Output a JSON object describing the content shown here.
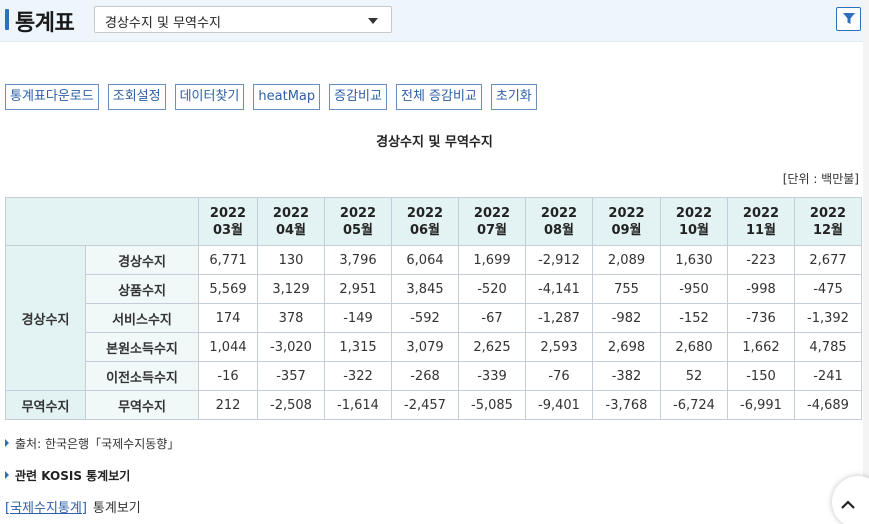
{
  "header": {
    "title": "통계표",
    "select_value": "경상수지 및 무역수지"
  },
  "toolbar": {
    "buttons": [
      "통계표다운로드",
      "조회설정",
      "데이터찾기",
      "heatMap",
      "증감비교",
      "전체 증감비교",
      "초기화"
    ]
  },
  "table": {
    "title": "경상수지 및 무역수지",
    "unit": "[단위 : 백만불]",
    "columns": [
      {
        "year": "2022",
        "month": "03월"
      },
      {
        "year": "2022",
        "month": "04월"
      },
      {
        "year": "2022",
        "month": "05월"
      },
      {
        "year": "2022",
        "month": "06월"
      },
      {
        "year": "2022",
        "month": "07월"
      },
      {
        "year": "2022",
        "month": "08월"
      },
      {
        "year": "2022",
        "month": "09월"
      },
      {
        "year": "2022",
        "month": "10월"
      },
      {
        "year": "2022",
        "month": "11월"
      },
      {
        "year": "2022",
        "month": "12월"
      }
    ],
    "groups": [
      {
        "label": "경상수지",
        "rows": [
          {
            "label": "경상수지",
            "values": [
              "6,771",
              "130",
              "3,796",
              "6,064",
              "1,699",
              "-2,912",
              "2,089",
              "1,630",
              "-223",
              "2,677"
            ]
          },
          {
            "label": "상품수지",
            "values": [
              "5,569",
              "3,129",
              "2,951",
              "3,845",
              "-520",
              "-4,141",
              "755",
              "-950",
              "-998",
              "-475"
            ]
          },
          {
            "label": "서비스수지",
            "values": [
              "174",
              "378",
              "-149",
              "-592",
              "-67",
              "-1,287",
              "-982",
              "-152",
              "-736",
              "-1,392"
            ]
          },
          {
            "label": "본원소득수지",
            "values": [
              "1,044",
              "-3,020",
              "1,315",
              "3,079",
              "2,625",
              "2,593",
              "2,698",
              "2,680",
              "1,662",
              "4,785"
            ]
          },
          {
            "label": "이전소득수지",
            "values": [
              "-16",
              "-357",
              "-322",
              "-268",
              "-339",
              "-76",
              "-382",
              "52",
              "-150",
              "-241"
            ]
          }
        ]
      },
      {
        "label": "무역수지",
        "rows": [
          {
            "label": "무역수지",
            "values": [
              "212",
              "-2,508",
              "-1,614",
              "-2,457",
              "-5,085",
              "-9,401",
              "-3,768",
              "-6,724",
              "-6,991",
              "-4,689"
            ]
          }
        ]
      }
    ]
  },
  "footer": {
    "source": "출처: 한국은행「국제수지동향」",
    "related": "관련 KOSIS 통계보기",
    "link_text": "[국제수지통계]",
    "link_suffix": "통계보기"
  },
  "colors": {
    "accent": "#2f6fc0",
    "header_bg": "#eef5fb",
    "table_header_bg": "#e3f3f3",
    "border": "#c5ced8"
  },
  "icons": {
    "filter": "filter-icon",
    "dropdown": "chevron-down-icon",
    "scroll_top": "chevron-up-icon"
  }
}
